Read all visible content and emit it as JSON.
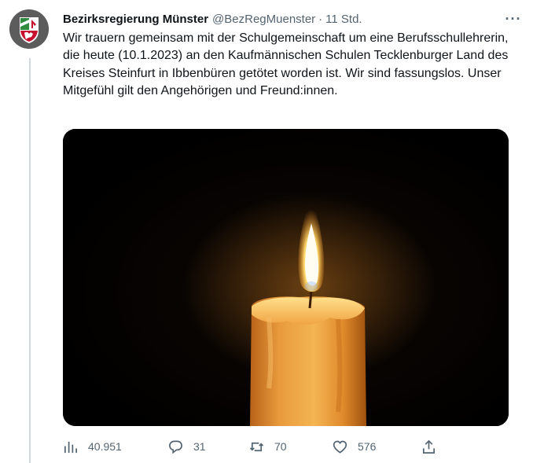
{
  "tweet": {
    "display_name": "Bezirksregierung Münster",
    "handle": "@BezRegMuenster",
    "separator": "·",
    "time": "11 Std.",
    "more_label": "···",
    "text": "Wir trauern gemeinsam mit der Schulgemeinschaft um eine Berufsschullehrerin, die heute (10.1.2023) an den Kaufmännischen Schulen Tecklenburger Land des Kreises Steinfurt in Ibbenbüren getötet worden ist. Wir sind fassungslos. Unser Mitgefühl gilt den Angehörigen und Freund:innen."
  },
  "media": {
    "subject": "lit candle on black background"
  },
  "actions": {
    "views": {
      "icon": "analytics-icon",
      "count": "40.951"
    },
    "replies": {
      "icon": "reply-icon",
      "count": "31"
    },
    "retweets": {
      "icon": "retweet-icon",
      "count": "70"
    },
    "likes": {
      "icon": "heart-icon",
      "count": "576"
    },
    "share": {
      "icon": "share-icon"
    }
  },
  "colors": {
    "text": "#0f1419",
    "secondary": "#536471",
    "thread_line": "#cfd9de"
  }
}
